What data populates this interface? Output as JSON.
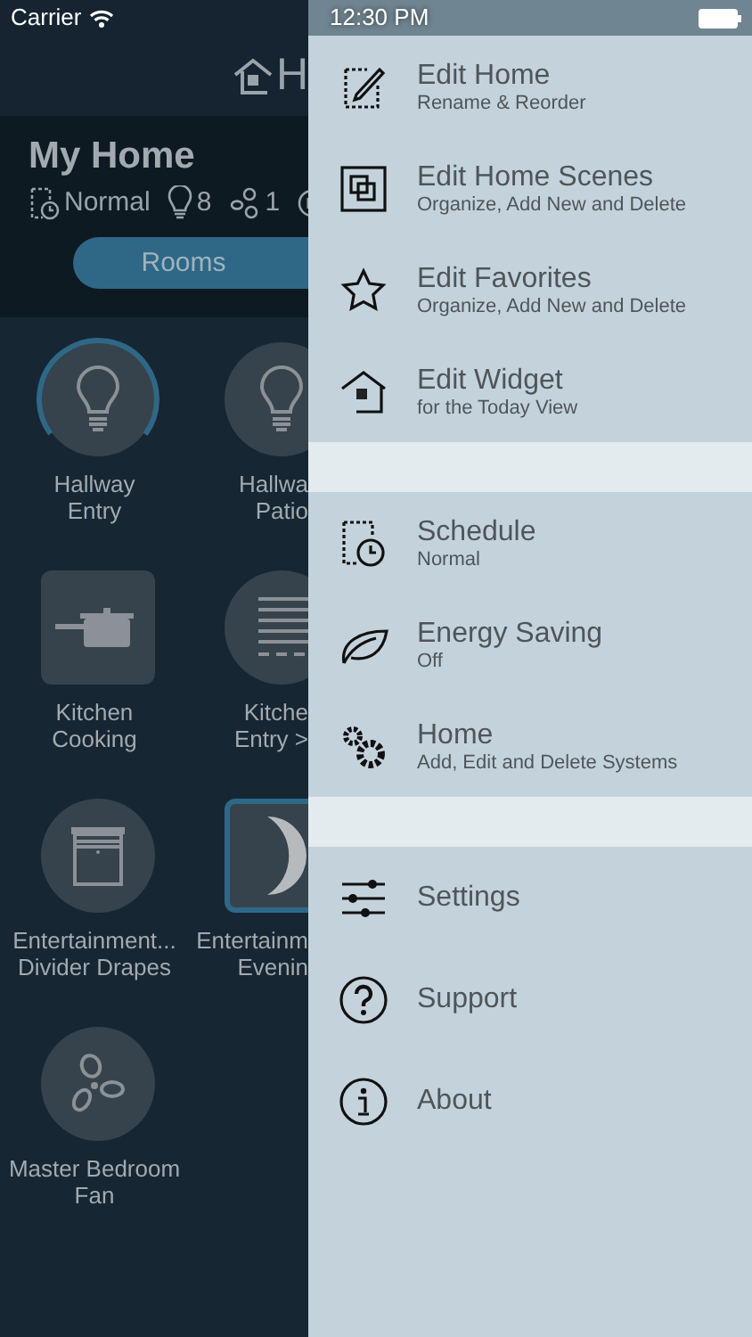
{
  "status_bar": {
    "carrier": "Carrier",
    "time": "12:30 PM"
  },
  "header": {
    "title": "H"
  },
  "home": {
    "name": "My Home",
    "stats": [
      "Normal",
      "8",
      "1"
    ],
    "tabs": [
      {
        "label": "Rooms",
        "selected": true
      }
    ]
  },
  "tiles": [
    {
      "kind": "device",
      "line1": "Hallway",
      "line2": "Entry",
      "level": 0.7,
      "selected": false
    },
    {
      "kind": "device",
      "line1": "Hallwa",
      "line2": "Patio",
      "selected": false
    },
    {
      "kind": "scene",
      "line1": "Kitchen",
      "line2": "Cooking",
      "selected": false
    },
    {
      "kind": "device",
      "line1": "Kitche",
      "line2": "Entry >",
      "selected": false
    },
    {
      "kind": "device",
      "line1": "Entertainment...",
      "line2": "Divider Drapes",
      "selected": false
    },
    {
      "kind": "scene",
      "line1": "Entertainm",
      "line2": "Evenin",
      "selected": true
    },
    {
      "kind": "device",
      "line1": "Master Bedroom",
      "line2": "Fan",
      "selected": false
    }
  ],
  "menu_sections": [
    [
      {
        "title": "Edit Home",
        "subtitle": "Rename & Reorder"
      },
      {
        "title": "Edit Home Scenes",
        "subtitle": "Organize, Add New and Delete"
      },
      {
        "title": "Edit Favorites",
        "subtitle": "Organize, Add New and Delete"
      },
      {
        "title": "Edit Widget",
        "subtitle": "for the Today View"
      }
    ],
    [
      {
        "title": "Schedule",
        "subtitle": "Normal"
      },
      {
        "title": "Energy Saving",
        "subtitle": "Off"
      },
      {
        "title": "Home",
        "subtitle": "Add, Edit and Delete Systems"
      }
    ],
    [
      {
        "title": "Settings"
      },
      {
        "title": "Support"
      },
      {
        "title": "About"
      }
    ]
  ]
}
